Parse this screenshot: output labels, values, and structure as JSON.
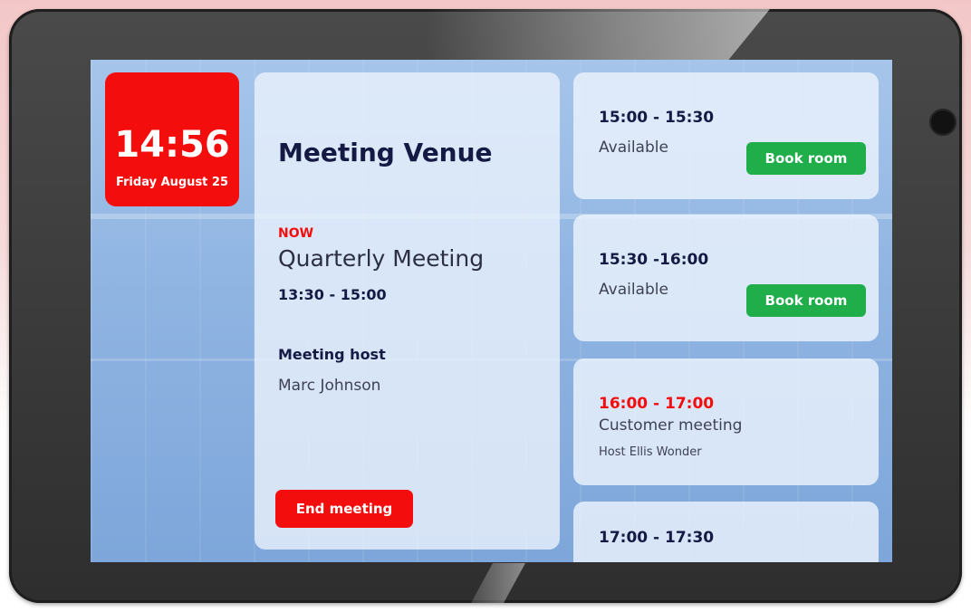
{
  "clock": {
    "time": "14:56",
    "date": "Friday August 25"
  },
  "venue": {
    "title": "Meeting Venue"
  },
  "current_meeting": {
    "now_label": "NOW",
    "title": "Quarterly Meeting",
    "time": "13:30 - 15:00",
    "host_label": "Meeting host",
    "host_name": "Marc Johnson",
    "end_button_label": "End meeting"
  },
  "schedule": [
    {
      "time": "15:00 - 15:30",
      "status": "Available",
      "button_label": "Book room"
    },
    {
      "time": "15:30 -16:00",
      "status": "Available",
      "button_label": "Book room"
    },
    {
      "time": "16:00 - 17:00",
      "status": "Customer meeting",
      "host": "Host Ellis Wonder"
    },
    {
      "time": "17:00 - 17:30"
    }
  ],
  "colors": {
    "accent_red": "#f40d0d",
    "available_green": "#1fae4a",
    "heading_navy": "#141a44",
    "device_frame": "#3a3a3a"
  }
}
